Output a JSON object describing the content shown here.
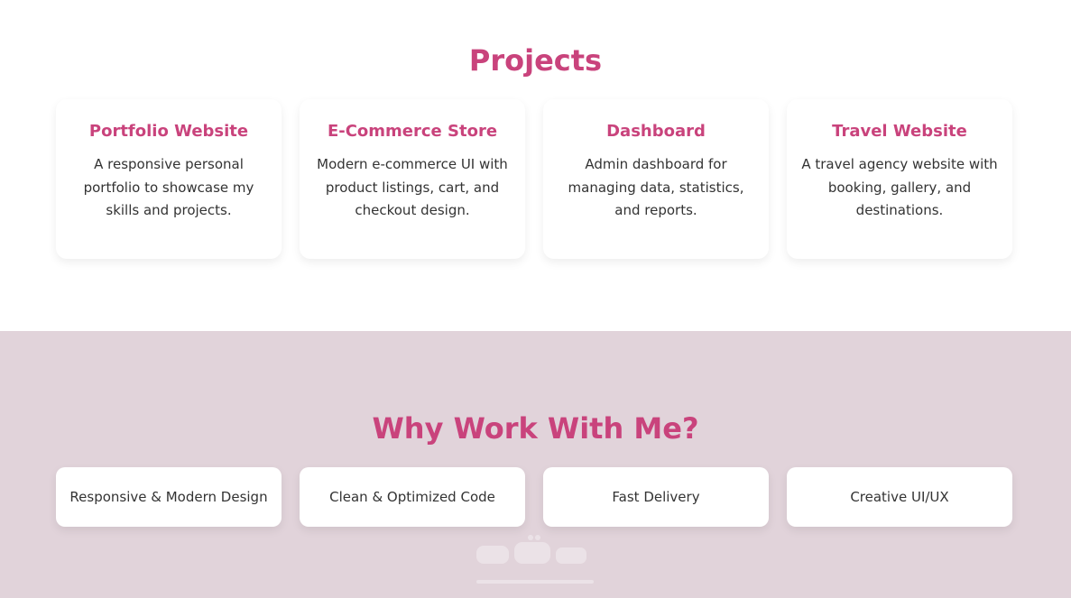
{
  "projects": {
    "title": "Projects",
    "cards": [
      {
        "title": "Portfolio Website",
        "description": "A responsive personal portfolio to showcase my skills and projects."
      },
      {
        "title": "E-Commerce Store",
        "description": "Modern e-commerce UI with product listings, cart, and checkout design."
      },
      {
        "title": "Dashboard",
        "description": "Admin dashboard for managing data, statistics, and reports."
      },
      {
        "title": "Travel Website",
        "description": "A travel agency website with booking, gallery, and destinations."
      }
    ]
  },
  "why": {
    "title": "Why Work With Me?",
    "items": [
      {
        "label": "Responsive & Modern Design"
      },
      {
        "label": "Clean & Optimized Code"
      },
      {
        "label": "Fast Delivery"
      },
      {
        "label": "Creative UI/UX"
      }
    ]
  },
  "colors": {
    "accent": "#c9437c",
    "why_background": "#e1d3da"
  }
}
